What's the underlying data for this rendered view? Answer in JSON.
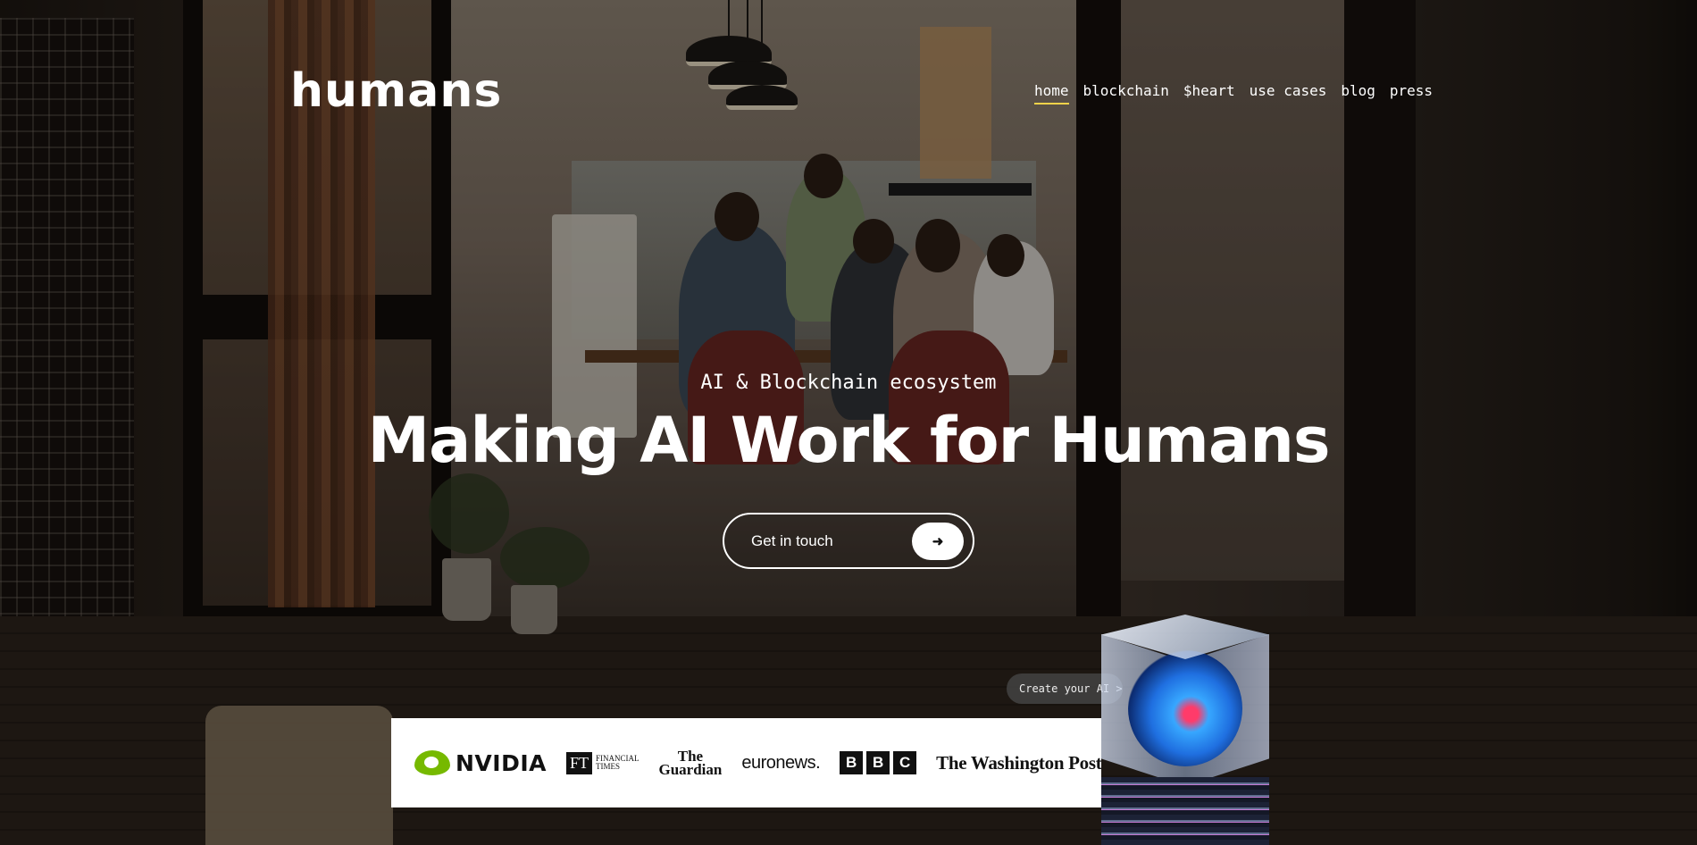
{
  "header": {
    "logo_text": "humans",
    "nav": [
      {
        "label": "home",
        "active": true
      },
      {
        "label": "blockchain",
        "active": false
      },
      {
        "label": "$heart",
        "active": false
      },
      {
        "label": "use cases",
        "active": false
      },
      {
        "label": "blog",
        "active": false
      },
      {
        "label": "press",
        "active": false
      }
    ]
  },
  "hero": {
    "eyebrow": "AI & Blockchain ecosystem",
    "headline": "Making AI Work for Humans",
    "cta_label": "Get in touch",
    "cta_icon": "arrow-right-icon"
  },
  "press_logos": {
    "nvidia": "NVIDIA",
    "ft_mark": "FT",
    "ft_line1": "FINANCIAL",
    "ft_line2": "TIMES",
    "guardian_line1": "The",
    "guardian_line2": "Guardian",
    "euronews": "euronews.",
    "bbc": [
      "B",
      "B",
      "C"
    ],
    "washington_post": "The Washington Post"
  },
  "create_ai": {
    "label": "Create your AI >"
  },
  "colors": {
    "nav_active_underline": "#f1d24a",
    "nvidia_green": "#76b900",
    "text": "#ffffff"
  }
}
